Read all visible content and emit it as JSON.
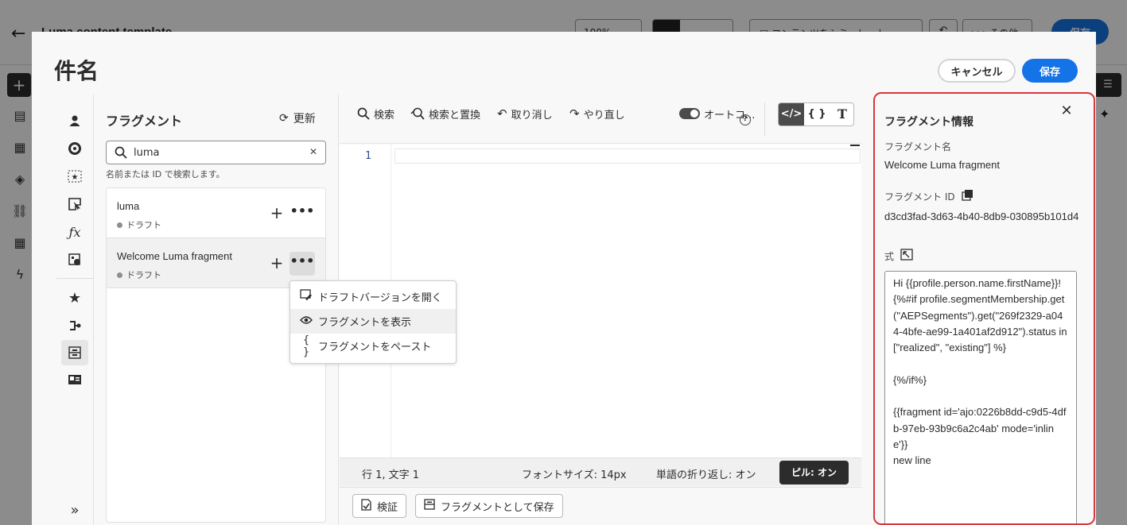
{
  "background": {
    "title": "Luma content template",
    "zoom": "100%",
    "simulate_label": "コンテンツをシミュレート",
    "more_label": "その他",
    "save_label": "保存"
  },
  "dialog": {
    "title": "件名",
    "cancel_label": "キャンセル",
    "save_label": "保存"
  },
  "rail": {
    "items": [
      "profile-icon",
      "audience-icon",
      "offer-icon",
      "context-icon",
      "function-icon",
      "helper-icon",
      "favorites-icon",
      "flow-icon",
      "fragment-icon",
      "contact-card-icon"
    ],
    "expand_label": "»"
  },
  "fragments": {
    "heading": "フラグメント",
    "refresh_label": "更新",
    "search": {
      "value": "luma",
      "help": "名前または ID で検索します。"
    },
    "items": [
      {
        "name": "luma",
        "status": "ドラフト"
      },
      {
        "name": "Welcome Luma fragment",
        "status": "ドラフト"
      }
    ],
    "more_label": "•••"
  },
  "context_menu": {
    "items": [
      {
        "icon": "edit-draft-icon",
        "label": "ドラフトバージョンを開く"
      },
      {
        "icon": "eye-icon",
        "label": "フラグメントを表示"
      },
      {
        "icon": "braces-icon",
        "label": "フラグメントをペースト"
      }
    ]
  },
  "editor": {
    "toolbar": {
      "search": "検索",
      "find_replace": "検索と置換",
      "undo": "取り消し",
      "redo": "やり直し",
      "autocomplete": "オートコ...",
      "help": "?"
    },
    "modes": [
      "</>",
      "{ }",
      "T"
    ],
    "line_number": "1",
    "status": {
      "position": "行 1, 文字 1",
      "font_size": "フォントサイズ: 14px",
      "word_wrap": "単語の折り返し: オン",
      "pill": "ピル: オン"
    },
    "validate_label": "検証",
    "save_as_fragment_label": "フラグメントとして保存"
  },
  "info": {
    "title": "フラグメント情報",
    "name_label": "フラグメント名",
    "name_value": "Welcome Luma fragment",
    "id_label": "フラグメント ID",
    "id_value": "d3cd3fad-3d63-4b40-8db9-030895b101d4",
    "expression_label": "式",
    "expression": "Hi {{profile.person.name.firstName}}!\n{%#if profile.segmentMembership.get(\"AEPSegments\").get(\"269f2329-a044-4bfe-ae99-1a401af2d912\").status in [\"realized\", \"existing\"] %}\n\n{%/if%}\n\n{{fragment id='ajo:0226b8dd-c9d5-4dfb-97eb-93b9c6a2c4ab' mode='inline'}}\nnew line"
  },
  "colors": {
    "accent": "#1473e6",
    "highlight_border": "#d7373f"
  }
}
